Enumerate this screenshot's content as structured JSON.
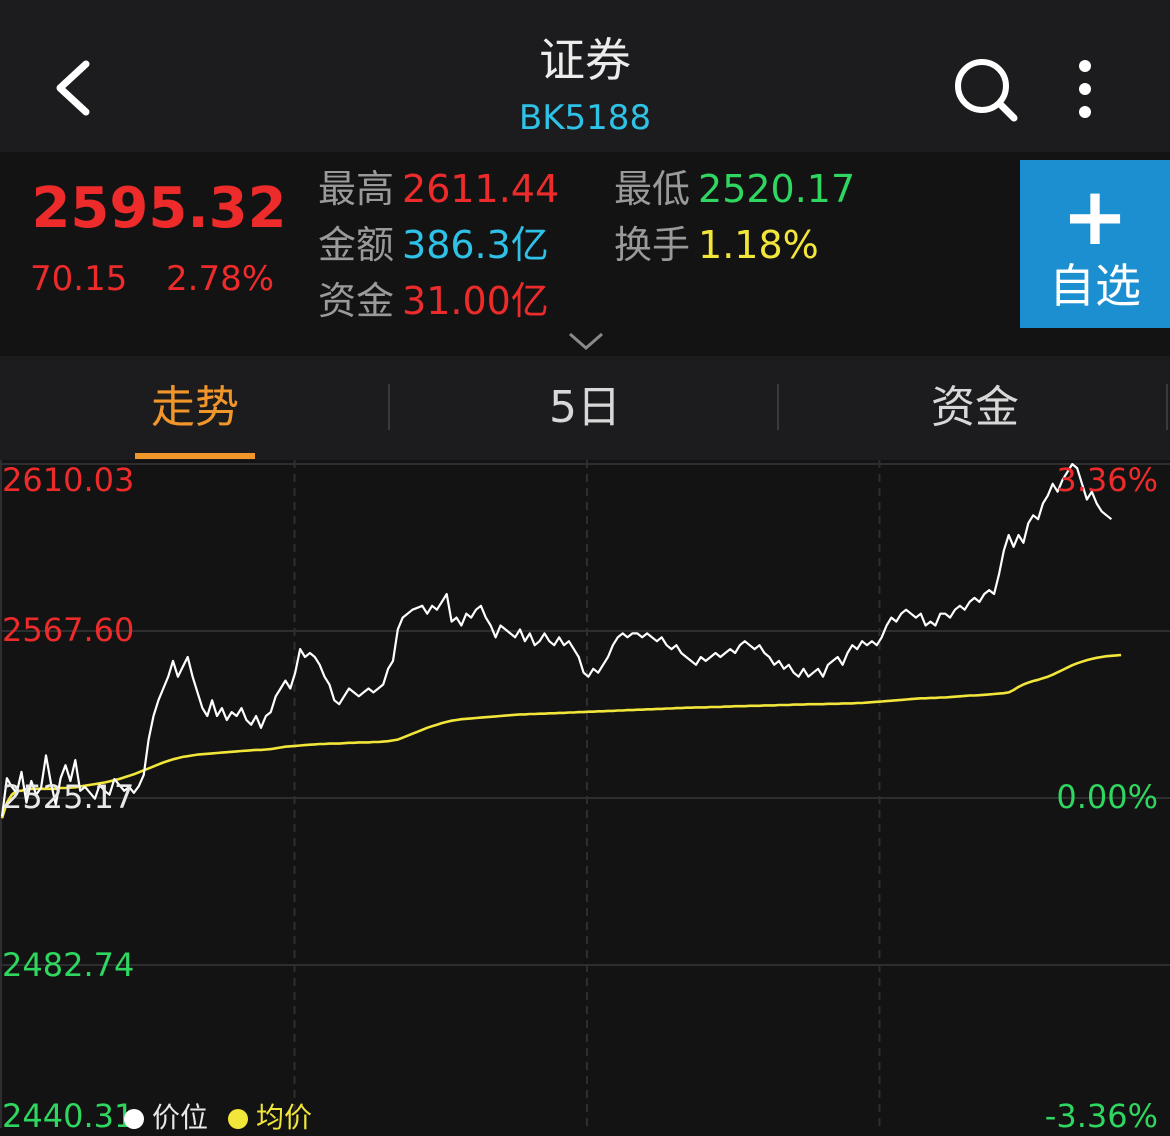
{
  "header": {
    "title": "证券",
    "code": "BK5188"
  },
  "quote": {
    "price": "2595.32",
    "change": "70.15",
    "change_pct": "2.78%",
    "high_label": "最高",
    "high": "2611.44",
    "low_label": "最低",
    "low": "2520.17",
    "amount_label": "金额",
    "amount": "386.3亿",
    "turnover_label": "换手",
    "turnover": "1.18%",
    "fund_label": "资金",
    "fund": "31.00亿",
    "add_label": "自选"
  },
  "tabs": [
    {
      "label": "走势",
      "active": true
    },
    {
      "label": "5日",
      "active": false
    },
    {
      "label": "资金",
      "active": false
    }
  ],
  "colors": {
    "up": "#ee2b2b",
    "down": "#2fd65f",
    "accent": "#f0962a",
    "price_line": "#ffffff",
    "avg_line": "#f2e63a",
    "button": "#1c8fd0"
  },
  "icons": [
    "back-arrow-icon",
    "search-icon",
    "more-vertical-icon",
    "plus-icon",
    "chevron-down-icon"
  ],
  "chart_data": {
    "type": "line",
    "y_axis_left": [
      "2610.03",
      "2567.60",
      "2525.17",
      "2482.74",
      "2440.31"
    ],
    "y_axis_right": [
      "3.36%",
      "0.00%",
      "-3.36%"
    ],
    "ylim": [
      2440.31,
      2610.03
    ],
    "base": 2525.17,
    "x_points": 240,
    "legend": [
      "价位",
      "均价"
    ],
    "series": [
      {
        "name": "价位",
        "color": "#ffffff",
        "values": [
          2520.5,
          2530.2,
          2528.0,
          2526.5,
          2531.8,
          2524.0,
          2529.5,
          2526.0,
          2527.8,
          2536.0,
          2529.0,
          2523.5,
          2530.2,
          2533.5,
          2529.5,
          2534.8,
          2527.0,
          2528.0,
          2526.5,
          2525.0,
          2528.5,
          2527.0,
          2526.0,
          2530.0,
          2528.5,
          2527.0,
          2528.0,
          2526.5,
          2528.2,
          2531.0,
          2540.0,
          2546.0,
          2550.0,
          2553.0,
          2556.0,
          2560.0,
          2556.0,
          2558.5,
          2561.0,
          2556.0,
          2552.0,
          2548.0,
          2546.0,
          2550.0,
          2546.0,
          2548.0,
          2545.0,
          2547.0,
          2546.0,
          2548.0,
          2545.0,
          2543.8,
          2546.0,
          2543.0,
          2546.0,
          2547.0,
          2551.0,
          2553.0,
          2555.0,
          2553.0,
          2557.0,
          2563.0,
          2561.0,
          2562.0,
          2561.0,
          2559.0,
          2556.0,
          2554.0,
          2550.0,
          2549.0,
          2551.0,
          2553.0,
          2552.0,
          2551.0,
          2552.0,
          2553.0,
          2552.0,
          2553.0,
          2554.0,
          2558.0,
          2560.0,
          2568.0,
          2571.0,
          2572.0,
          2573.0,
          2573.5,
          2574.0,
          2572.0,
          2574.0,
          2573.0,
          2575.0,
          2577.0,
          2570.0,
          2571.0,
          2569.0,
          2572.0,
          2571.0,
          2573.0,
          2574.0,
          2571.0,
          2569.0,
          2566.0,
          2569.0,
          2568.0,
          2567.0,
          2566.0,
          2568.0,
          2565.0,
          2567.0,
          2564.0,
          2565.0,
          2567.0,
          2565.0,
          2564.0,
          2566.0,
          2564.0,
          2565.0,
          2563.0,
          2561.0,
          2557.0,
          2556.0,
          2558.0,
          2557.0,
          2559.0,
          2561.0,
          2564.0,
          2566.0,
          2567.0,
          2566.0,
          2567.0,
          2567.0,
          2566.0,
          2567.0,
          2566.0,
          2565.0,
          2566.0,
          2564.0,
          2563.0,
          2564.0,
          2562.0,
          2561.0,
          2560.0,
          2559.0,
          2561.0,
          2560.0,
          2561.0,
          2562.0,
          2561.0,
          2562.0,
          2563.0,
          2562.0,
          2564.0,
          2565.0,
          2564.0,
          2563.0,
          2564.0,
          2562.0,
          2561.0,
          2559.0,
          2560.0,
          2558.0,
          2559.0,
          2557.0,
          2556.0,
          2558.0,
          2556.0,
          2557.0,
          2558.0,
          2556.0,
          2559.0,
          2560.0,
          2561.0,
          2559.0,
          2562.0,
          2564.0,
          2563.0,
          2565.0,
          2564.0,
          2565.0,
          2564.0,
          2566.0,
          2569.0,
          2571.0,
          2570.0,
          2572.0,
          2573.0,
          2572.0,
          2571.0,
          2572.0,
          2569.0,
          2570.0,
          2569.0,
          2572.0,
          2572.0,
          2571.0,
          2573.0,
          2574.0,
          2573.0,
          2575.0,
          2576.0,
          2575.0,
          2577.0,
          2578.0,
          2577.0,
          2582.0,
          2588.0,
          2592.0,
          2589.0,
          2592.0,
          2590.0,
          2595.0,
          2597.0,
          2596.0,
          2600.0,
          2602.0,
          2605.0,
          2603.0,
          2606.0,
          2608.0,
          2610.0,
          2609.0,
          2605.0,
          2601.0,
          2603.0,
          2600.0,
          2598.0,
          2597.0,
          2596.0
        ]
      },
      {
        "name": "均价",
        "color": "#f2e63a",
        "values": [
          2520.0,
          2524.0,
          2526.0,
          2527.0,
          2527.0,
          2527.5,
          2527.5,
          2527.5,
          2527.5,
          2527.5,
          2527.5,
          2527.5,
          2527.7,
          2527.7,
          2527.8,
          2527.9,
          2528.1,
          2528.3,
          2528.5,
          2528.7,
          2528.9,
          2529.1,
          2529.4,
          2529.7,
          2530.0,
          2530.4,
          2530.8,
          2531.2,
          2531.7,
          2532.2,
          2532.7,
          2533.2,
          2533.7,
          2534.2,
          2534.6,
          2535.0,
          2535.3,
          2535.6,
          2535.8,
          2536.0,
          2536.2,
          2536.3,
          2536.4,
          2536.5,
          2536.6,
          2536.7,
          2536.8,
          2536.9,
          2537.0,
          2537.1,
          2537.2,
          2537.3,
          2537.4,
          2537.4,
          2537.5,
          2537.6,
          2537.8,
          2538.0,
          2538.2,
          2538.3,
          2538.4,
          2538.5,
          2538.6,
          2538.7,
          2538.8,
          2538.9,
          2538.9,
          2539.0,
          2539.0,
          2539.0,
          2539.1,
          2539.2,
          2539.2,
          2539.3,
          2539.3,
          2539.3,
          2539.4,
          2539.4,
          2539.5,
          2539.6,
          2539.8,
          2540.0,
          2540.5,
          2541.0,
          2541.5,
          2542.0,
          2542.5,
          2543.0,
          2543.4,
          2543.8,
          2544.2,
          2544.5,
          2544.8,
          2545.0,
          2545.2,
          2545.3,
          2545.4,
          2545.5,
          2545.6,
          2545.7,
          2545.8,
          2545.9,
          2546.0,
          2546.1,
          2546.2,
          2546.3,
          2546.4,
          2546.4,
          2546.5,
          2546.5,
          2546.6,
          2546.6,
          2546.7,
          2546.7,
          2546.8,
          2546.8,
          2546.9,
          2546.9,
          2547.0,
          2547.0,
          2547.1,
          2547.1,
          2547.2,
          2547.2,
          2547.3,
          2547.3,
          2547.4,
          2547.4,
          2547.5,
          2547.5,
          2547.6,
          2547.6,
          2547.7,
          2547.7,
          2547.8,
          2547.8,
          2547.9,
          2547.9,
          2548.0,
          2548.0,
          2548.1,
          2548.1,
          2548.2,
          2548.2,
          2548.2,
          2548.3,
          2548.3,
          2548.3,
          2548.4,
          2548.4,
          2548.5,
          2548.5,
          2548.5,
          2548.6,
          2548.6,
          2548.6,
          2548.7,
          2548.7,
          2548.7,
          2548.8,
          2548.8,
          2548.8,
          2548.9,
          2548.9,
          2548.9,
          2549.0,
          2549.0,
          2549.0,
          2549.0,
          2549.1,
          2549.1,
          2549.1,
          2549.2,
          2549.2,
          2549.2,
          2549.3,
          2549.3,
          2549.4,
          2549.5,
          2549.6,
          2549.7,
          2549.8,
          2549.9,
          2550.0,
          2550.1,
          2550.2,
          2550.3,
          2550.4,
          2550.5,
          2550.5,
          2550.6,
          2550.6,
          2550.7,
          2550.7,
          2550.8,
          2550.9,
          2551.0,
          2551.1,
          2551.2,
          2551.2,
          2551.3,
          2551.4,
          2551.5,
          2551.6,
          2551.7,
          2551.8,
          2552.0,
          2552.6,
          2553.4,
          2554.0,
          2554.5,
          2554.9,
          2555.2,
          2555.6,
          2556.0,
          2556.5,
          2557.1,
          2557.7,
          2558.3,
          2558.9,
          2559.4,
          2559.8,
          2560.2,
          2560.5,
          2560.8,
          2561.0,
          2561.2,
          2561.3,
          2561.4,
          2561.5
        ]
      }
    ]
  }
}
